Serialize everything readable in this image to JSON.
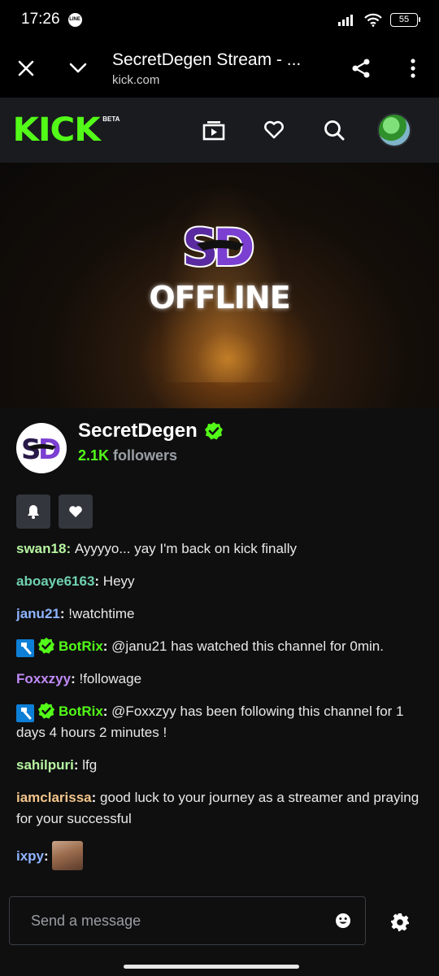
{
  "status_bar": {
    "time": "17:26",
    "line_badge": "LINE",
    "battery": "55"
  },
  "browser": {
    "title": "SecretDegen Stream - ...",
    "url": "kick.com"
  },
  "kick": {
    "logo": "KICK",
    "beta": "BETA"
  },
  "video": {
    "offline_label": "OFFLINE"
  },
  "channel": {
    "name": "SecretDegen",
    "followers_count": "2.1K",
    "followers_label": "followers"
  },
  "chat": {
    "messages": [
      {
        "user": "swan18",
        "color": "#b7f5a0",
        "text": "Ayyyyo... yay I'm back on kick finally"
      },
      {
        "user": "aboaye6163",
        "color": "#6fd1b0",
        "text": "Heyy"
      },
      {
        "user": "janu21",
        "color": "#8fb4ff",
        "text": "!watchtime"
      },
      {
        "user": "BotRix",
        "color": "#53fc18",
        "text": "@janu21 has watched this channel for 0min."
      },
      {
        "user": "Foxxzyy",
        "color": "#c08af5",
        "text": "!followage"
      },
      {
        "user": "BotRix",
        "color": "#53fc18",
        "text": "@Foxxzyy has been following this channel for 1 days 4 hours 2 minutes !"
      },
      {
        "user": "sahilpuri",
        "color": "#b7f5a0",
        "text": "lfg"
      },
      {
        "user": "iamclarissa",
        "color": "#f3c58a",
        "text": "good luck to your journey as a streamer and praying for your successful"
      },
      {
        "user": "ixpy",
        "color": "#8fb4ff",
        "text": ""
      }
    ]
  },
  "input": {
    "placeholder": "Send a message"
  },
  "icons": [
    "close-icon",
    "chevron-down-icon",
    "share-icon",
    "more-vert-icon",
    "browse-icon",
    "heart-icon",
    "search-icon",
    "bell-icon",
    "verified-icon",
    "mod-hammer-icon",
    "emoji-icon",
    "gear-icon"
  ],
  "colors": {
    "kick_green": "#53fc18",
    "header_bg": "#191b1f",
    "page_bg": "#0f0f10"
  }
}
